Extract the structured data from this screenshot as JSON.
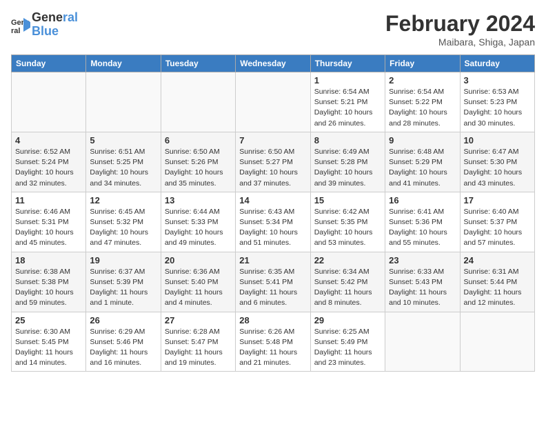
{
  "header": {
    "logo_line1": "General",
    "logo_line2": "Blue",
    "main_title": "February 2024",
    "subtitle": "Maibara, Shiga, Japan"
  },
  "columns": [
    "Sunday",
    "Monday",
    "Tuesday",
    "Wednesday",
    "Thursday",
    "Friday",
    "Saturday"
  ],
  "weeks": [
    [
      {
        "day": "",
        "info": ""
      },
      {
        "day": "",
        "info": ""
      },
      {
        "day": "",
        "info": ""
      },
      {
        "day": "",
        "info": ""
      },
      {
        "day": "1",
        "info": "Sunrise: 6:54 AM\nSunset: 5:21 PM\nDaylight: 10 hours\nand 26 minutes."
      },
      {
        "day": "2",
        "info": "Sunrise: 6:54 AM\nSunset: 5:22 PM\nDaylight: 10 hours\nand 28 minutes."
      },
      {
        "day": "3",
        "info": "Sunrise: 6:53 AM\nSunset: 5:23 PM\nDaylight: 10 hours\nand 30 minutes."
      }
    ],
    [
      {
        "day": "4",
        "info": "Sunrise: 6:52 AM\nSunset: 5:24 PM\nDaylight: 10 hours\nand 32 minutes."
      },
      {
        "day": "5",
        "info": "Sunrise: 6:51 AM\nSunset: 5:25 PM\nDaylight: 10 hours\nand 34 minutes."
      },
      {
        "day": "6",
        "info": "Sunrise: 6:50 AM\nSunset: 5:26 PM\nDaylight: 10 hours\nand 35 minutes."
      },
      {
        "day": "7",
        "info": "Sunrise: 6:50 AM\nSunset: 5:27 PM\nDaylight: 10 hours\nand 37 minutes."
      },
      {
        "day": "8",
        "info": "Sunrise: 6:49 AM\nSunset: 5:28 PM\nDaylight: 10 hours\nand 39 minutes."
      },
      {
        "day": "9",
        "info": "Sunrise: 6:48 AM\nSunset: 5:29 PM\nDaylight: 10 hours\nand 41 minutes."
      },
      {
        "day": "10",
        "info": "Sunrise: 6:47 AM\nSunset: 5:30 PM\nDaylight: 10 hours\nand 43 minutes."
      }
    ],
    [
      {
        "day": "11",
        "info": "Sunrise: 6:46 AM\nSunset: 5:31 PM\nDaylight: 10 hours\nand 45 minutes."
      },
      {
        "day": "12",
        "info": "Sunrise: 6:45 AM\nSunset: 5:32 PM\nDaylight: 10 hours\nand 47 minutes."
      },
      {
        "day": "13",
        "info": "Sunrise: 6:44 AM\nSunset: 5:33 PM\nDaylight: 10 hours\nand 49 minutes."
      },
      {
        "day": "14",
        "info": "Sunrise: 6:43 AM\nSunset: 5:34 PM\nDaylight: 10 hours\nand 51 minutes."
      },
      {
        "day": "15",
        "info": "Sunrise: 6:42 AM\nSunset: 5:35 PM\nDaylight: 10 hours\nand 53 minutes."
      },
      {
        "day": "16",
        "info": "Sunrise: 6:41 AM\nSunset: 5:36 PM\nDaylight: 10 hours\nand 55 minutes."
      },
      {
        "day": "17",
        "info": "Sunrise: 6:40 AM\nSunset: 5:37 PM\nDaylight: 10 hours\nand 57 minutes."
      }
    ],
    [
      {
        "day": "18",
        "info": "Sunrise: 6:38 AM\nSunset: 5:38 PM\nDaylight: 10 hours\nand 59 minutes."
      },
      {
        "day": "19",
        "info": "Sunrise: 6:37 AM\nSunset: 5:39 PM\nDaylight: 11 hours\nand 1 minute."
      },
      {
        "day": "20",
        "info": "Sunrise: 6:36 AM\nSunset: 5:40 PM\nDaylight: 11 hours\nand 4 minutes."
      },
      {
        "day": "21",
        "info": "Sunrise: 6:35 AM\nSunset: 5:41 PM\nDaylight: 11 hours\nand 6 minutes."
      },
      {
        "day": "22",
        "info": "Sunrise: 6:34 AM\nSunset: 5:42 PM\nDaylight: 11 hours\nand 8 minutes."
      },
      {
        "day": "23",
        "info": "Sunrise: 6:33 AM\nSunset: 5:43 PM\nDaylight: 11 hours\nand 10 minutes."
      },
      {
        "day": "24",
        "info": "Sunrise: 6:31 AM\nSunset: 5:44 PM\nDaylight: 11 hours\nand 12 minutes."
      }
    ],
    [
      {
        "day": "25",
        "info": "Sunrise: 6:30 AM\nSunset: 5:45 PM\nDaylight: 11 hours\nand 14 minutes."
      },
      {
        "day": "26",
        "info": "Sunrise: 6:29 AM\nSunset: 5:46 PM\nDaylight: 11 hours\nand 16 minutes."
      },
      {
        "day": "27",
        "info": "Sunrise: 6:28 AM\nSunset: 5:47 PM\nDaylight: 11 hours\nand 19 minutes."
      },
      {
        "day": "28",
        "info": "Sunrise: 6:26 AM\nSunset: 5:48 PM\nDaylight: 11 hours\nand 21 minutes."
      },
      {
        "day": "29",
        "info": "Sunrise: 6:25 AM\nSunset: 5:49 PM\nDaylight: 11 hours\nand 23 minutes."
      },
      {
        "day": "",
        "info": ""
      },
      {
        "day": "",
        "info": ""
      }
    ]
  ]
}
